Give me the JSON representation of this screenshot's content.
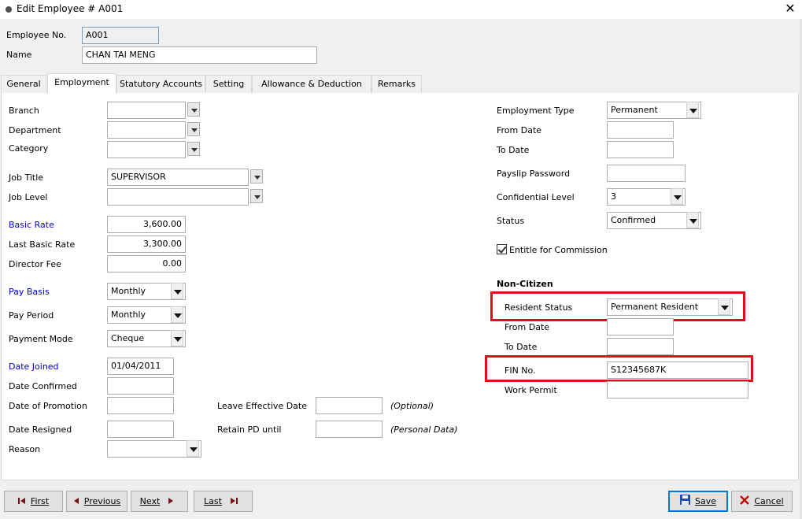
{
  "window": {
    "title": "Edit Employee # A001",
    "close_glyph": "✕"
  },
  "header": {
    "employee_no_label": "Employee No.",
    "employee_no_value": "A001",
    "name_label": "Name",
    "name_value": "CHAN TAI MENG"
  },
  "tabs": [
    {
      "label": "General",
      "active": false
    },
    {
      "label": "Employment",
      "active": true
    },
    {
      "label": "Statutory Accounts",
      "active": false
    },
    {
      "label": "Setting",
      "active": false
    },
    {
      "label": "Allowance & Deduction",
      "active": false
    },
    {
      "label": "Remarks",
      "active": false
    }
  ],
  "left": {
    "branch": {
      "label": "Branch",
      "value": ""
    },
    "department": {
      "label": "Department",
      "value": ""
    },
    "category": {
      "label": "Category",
      "value": ""
    },
    "job_title": {
      "label": "Job Title",
      "value": "SUPERVISOR"
    },
    "job_level": {
      "label": "Job Level",
      "value": ""
    },
    "basic_rate": {
      "label": "Basic Rate",
      "value": "3,600.00"
    },
    "last_basic_rate": {
      "label": "Last Basic Rate",
      "value": "3,300.00"
    },
    "director_fee": {
      "label": "Director Fee",
      "value": "0.00"
    },
    "pay_basis": {
      "label": "Pay Basis",
      "value": "Monthly"
    },
    "pay_period": {
      "label": "Pay Period",
      "value": "Monthly"
    },
    "payment_mode": {
      "label": "Payment Mode",
      "value": "Cheque"
    },
    "date_joined": {
      "label": "Date Joined",
      "value": "01/04/2011"
    },
    "date_confirmed": {
      "label": "Date Confirmed",
      "value": ""
    },
    "date_of_promotion": {
      "label": "Date of Promotion",
      "value": ""
    },
    "date_resigned": {
      "label": "Date Resigned",
      "value": ""
    },
    "reason": {
      "label": "Reason",
      "value": ""
    }
  },
  "middle": {
    "leave_effective_date": {
      "label": "Leave Effective Date",
      "value": "",
      "note": "(Optional)"
    },
    "retain_pd_until": {
      "label": "Retain PD until",
      "value": "",
      "note": "(Personal Data)"
    }
  },
  "right": {
    "employment_type": {
      "label": "Employment Type",
      "value": "Permanent"
    },
    "from_date": {
      "label": "From Date",
      "value": ""
    },
    "to_date": {
      "label": "To Date",
      "value": ""
    },
    "payslip_password": {
      "label": "Payslip Password",
      "value": ""
    },
    "confidential_level": {
      "label": "Confidential Level",
      "value": "3"
    },
    "status": {
      "label": "Status",
      "value": "Confirmed"
    },
    "entitle_commission": {
      "label": "Entitle for Commission",
      "checked": true
    },
    "non_citizen_heading": "Non-Citizen",
    "resident_status": {
      "label": "Resident Status",
      "value": "Permanent Resident"
    },
    "nc_from_date": {
      "label": "From Date",
      "value": ""
    },
    "nc_to_date": {
      "label": "To Date",
      "value": ""
    },
    "fin_no": {
      "label": "FIN No.",
      "value": "S12345687K"
    },
    "work_permit": {
      "label": "Work Permit",
      "value": ""
    }
  },
  "footer": {
    "first": {
      "label": "First",
      "icon": "first-record-icon"
    },
    "previous": {
      "label": "Previous",
      "icon": "previous-record-icon"
    },
    "next": {
      "label": "Next",
      "icon": "next-record-icon"
    },
    "last": {
      "label": "Last",
      "icon": "last-record-icon"
    },
    "save": {
      "label": "Save",
      "icon": "floppy-disk-icon"
    },
    "cancel": {
      "label": "Cancel",
      "icon": "cancel-x-icon"
    }
  },
  "colors": {
    "highlight_red": "#e0101a",
    "label_blue": "#0000c8",
    "default_button_border": "#0078d7"
  }
}
